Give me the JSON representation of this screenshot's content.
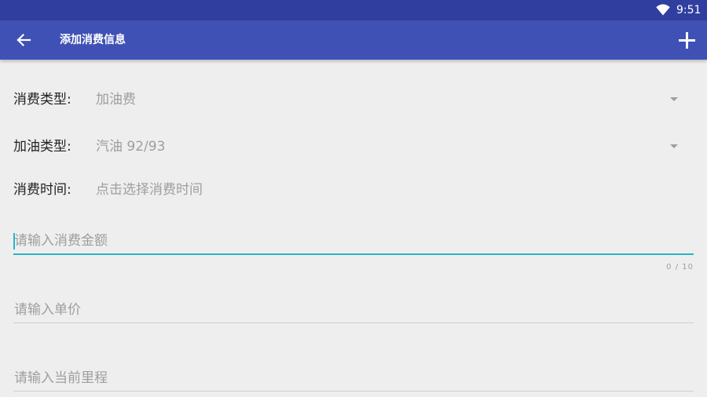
{
  "status_bar": {
    "time": "9:51",
    "wifi_icon": "wifi-icon"
  },
  "app_bar": {
    "title": "添加消费信息",
    "back_icon": "arrow-left-icon",
    "add_icon": "plus-icon"
  },
  "form": {
    "expense_type": {
      "label": "消费类型:",
      "value": "加油费"
    },
    "fuel_type": {
      "label": "加油类型:",
      "value": "汽油 92/93"
    },
    "expense_time": {
      "label": "消费时间:",
      "value": "点击选择消费时间"
    },
    "amount": {
      "placeholder": "请输入消费金额",
      "counter": "0 / 10"
    },
    "unit_price": {
      "placeholder": "请输入单价"
    },
    "mileage": {
      "placeholder": "请输入当前里程"
    }
  },
  "colors": {
    "status_bar": "#303f9f",
    "app_bar": "#3f51b5",
    "accent": "#26b5c9",
    "background": "#eeeeee"
  }
}
